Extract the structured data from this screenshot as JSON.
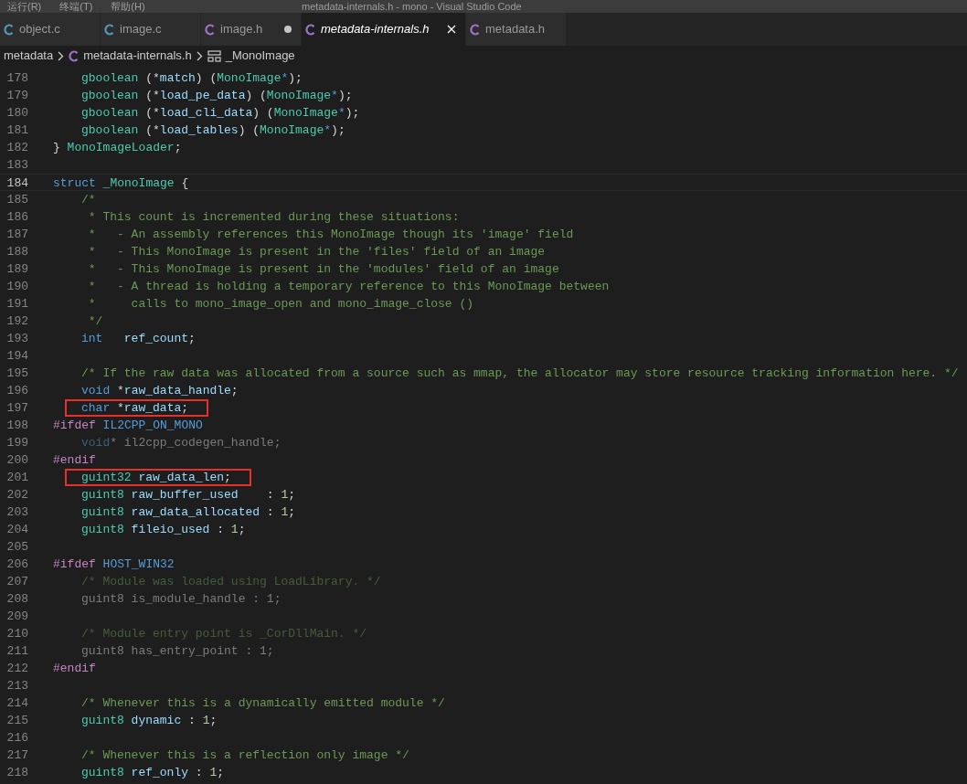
{
  "title_bar": {
    "menu": [
      "运行(R)",
      "终端(T)",
      "帮助(H)"
    ],
    "title": "metadata-internals.h - mono - Visual Studio Code"
  },
  "tabs": [
    {
      "label": "object.c",
      "kind": "c",
      "selected": false,
      "modified": false,
      "preview": false
    },
    {
      "label": "image.c",
      "kind": "c",
      "selected": false,
      "modified": false,
      "preview": false
    },
    {
      "label": "image.h",
      "kind": "h",
      "selected": false,
      "modified": true,
      "preview": false
    },
    {
      "label": "metadata-internals.h",
      "kind": "h",
      "selected": true,
      "modified": false,
      "preview": true
    },
    {
      "label": "metadata.h",
      "kind": "h",
      "selected": false,
      "modified": false,
      "preview": false
    }
  ],
  "breadcrumb": [
    {
      "label": "metadata",
      "kind": "folder"
    },
    {
      "label": "metadata-internals.h",
      "kind": "h"
    },
    {
      "label": "_MonoImage",
      "kind": "struct"
    }
  ],
  "lines": [
    {
      "number": "178",
      "indented": true,
      "current": false,
      "boxed": false,
      "inactive": false,
      "tokens": [
        {
          "kind": "type",
          "text": "gboolean"
        },
        {
          "kind": "plain",
          "text": " (*"
        },
        {
          "kind": "var",
          "text": "match"
        },
        {
          "kind": "plain",
          "text": ") ("
        },
        {
          "kind": "type",
          "text": "MonoImage"
        },
        {
          "kind": "keyword",
          "text": "*"
        },
        {
          "kind": "plain",
          "text": ");"
        }
      ]
    },
    {
      "number": "179",
      "indented": true,
      "current": false,
      "boxed": false,
      "inactive": false,
      "tokens": [
        {
          "kind": "type",
          "text": "gboolean"
        },
        {
          "kind": "plain",
          "text": " (*"
        },
        {
          "kind": "var",
          "text": "load_pe_data"
        },
        {
          "kind": "plain",
          "text": ") ("
        },
        {
          "kind": "type",
          "text": "MonoImage"
        },
        {
          "kind": "keyword",
          "text": "*"
        },
        {
          "kind": "plain",
          "text": ");"
        }
      ]
    },
    {
      "number": "180",
      "indented": true,
      "current": false,
      "boxed": false,
      "inactive": false,
      "tokens": [
        {
          "kind": "type",
          "text": "gboolean"
        },
        {
          "kind": "plain",
          "text": " (*"
        },
        {
          "kind": "var",
          "text": "load_cli_data"
        },
        {
          "kind": "plain",
          "text": ") ("
        },
        {
          "kind": "type",
          "text": "MonoImage"
        },
        {
          "kind": "keyword",
          "text": "*"
        },
        {
          "kind": "plain",
          "text": ");"
        }
      ]
    },
    {
      "number": "181",
      "indented": true,
      "current": false,
      "boxed": false,
      "inactive": false,
      "tokens": [
        {
          "kind": "type",
          "text": "gboolean"
        },
        {
          "kind": "plain",
          "text": " (*"
        },
        {
          "kind": "var",
          "text": "load_tables"
        },
        {
          "kind": "plain",
          "text": ") ("
        },
        {
          "kind": "type",
          "text": "MonoImage"
        },
        {
          "kind": "keyword",
          "text": "*"
        },
        {
          "kind": "plain",
          "text": ");"
        }
      ]
    },
    {
      "number": "182",
      "indented": false,
      "current": false,
      "boxed": false,
      "inactive": false,
      "tokens": [
        {
          "kind": "plain",
          "text": "} "
        },
        {
          "kind": "type",
          "text": "MonoImageLoader"
        },
        {
          "kind": "plain",
          "text": ";"
        }
      ]
    },
    {
      "number": "183",
      "current": false
    },
    {
      "number": "184",
      "indented": false,
      "current": true,
      "boxed": false,
      "inactive": false,
      "tokens": [
        {
          "kind": "keyword",
          "text": "struct "
        },
        {
          "kind": "type",
          "text": "_MonoImage"
        },
        {
          "kind": "plain",
          "text": " {"
        }
      ]
    },
    {
      "number": "185",
      "indented": true,
      "current": false,
      "boxed": false,
      "inactive": false,
      "tokens": [
        {
          "kind": "comment",
          "text": "/*"
        }
      ]
    },
    {
      "number": "186",
      "indented": true,
      "current": false,
      "boxed": false,
      "inactive": false,
      "tokens": [
        {
          "kind": "comment",
          "text": " * This count is incremented during these situations:"
        }
      ]
    },
    {
      "number": "187",
      "indented": true,
      "current": false,
      "boxed": false,
      "inactive": false,
      "tokens": [
        {
          "kind": "comment",
          "text": " *   - An assembly references this MonoImage though its 'image' field"
        }
      ]
    },
    {
      "number": "188",
      "indented": true,
      "current": false,
      "boxed": false,
      "inactive": false,
      "tokens": [
        {
          "kind": "comment",
          "text": " *   - This MonoImage is present in the 'files' field of an image"
        }
      ]
    },
    {
      "number": "189",
      "indented": true,
      "current": false,
      "boxed": false,
      "inactive": false,
      "tokens": [
        {
          "kind": "comment",
          "text": " *   - This MonoImage is present in the 'modules' field of an image"
        }
      ]
    },
    {
      "number": "190",
      "indented": true,
      "current": false,
      "boxed": false,
      "inactive": false,
      "tokens": [
        {
          "kind": "comment",
          "text": " *   - A thread is holding a temporary reference to this MonoImage between"
        }
      ]
    },
    {
      "number": "191",
      "indented": true,
      "current": false,
      "boxed": false,
      "inactive": false,
      "tokens": [
        {
          "kind": "comment",
          "text": " *     calls to mono_image_open and mono_image_close ()"
        }
      ]
    },
    {
      "number": "192",
      "indented": true,
      "current": false,
      "boxed": false,
      "inactive": false,
      "tokens": [
        {
          "kind": "comment",
          "text": " */"
        }
      ]
    },
    {
      "number": "193",
      "indented": true,
      "current": false,
      "boxed": false,
      "inactive": false,
      "tokens": [
        {
          "kind": "keyword",
          "text": "int   "
        },
        {
          "kind": "var",
          "text": "ref_count"
        },
        {
          "kind": "plain",
          "text": ";"
        }
      ]
    },
    {
      "number": "194",
      "current": false
    },
    {
      "number": "195",
      "indented": true,
      "current": false,
      "boxed": false,
      "inactive": false,
      "tokens": [
        {
          "kind": "comment",
          "text": "/* If the raw data was allocated from a source such as mmap, the allocator may store resource tracking information here. */"
        }
      ]
    },
    {
      "number": "196",
      "indented": true,
      "current": false,
      "boxed": false,
      "inactive": false,
      "tokens": [
        {
          "kind": "keyword",
          "text": "void"
        },
        {
          "kind": "plain",
          "text": " *"
        },
        {
          "kind": "var",
          "text": "raw_data_handle"
        },
        {
          "kind": "plain",
          "text": ";"
        }
      ]
    },
    {
      "number": "197",
      "indented": true,
      "current": false,
      "boxed": true,
      "inactive": false,
      "tokens": [
        {
          "kind": "keyword",
          "text": "char"
        },
        {
          "kind": "plain",
          "text": " *"
        },
        {
          "kind": "var",
          "text": "raw_data"
        },
        {
          "kind": "plain",
          "text": ";"
        }
      ]
    },
    {
      "number": "198",
      "indented": false,
      "current": false,
      "boxed": false,
      "inactive": false,
      "tokens": [
        {
          "kind": "macro",
          "text": "#ifdef "
        },
        {
          "kind": "keyword",
          "text": "IL2CPP_ON_MONO"
        }
      ]
    },
    {
      "number": "199",
      "indented": true,
      "current": false,
      "boxed": false,
      "inactive": true,
      "tokens": [
        {
          "kind": "keyword",
          "text": "void"
        },
        {
          "kind": "plain",
          "text": "* il2cpp_codegen_handle;"
        }
      ]
    },
    {
      "number": "200",
      "indented": false,
      "current": false,
      "boxed": false,
      "inactive": false,
      "tokens": [
        {
          "kind": "macro",
          "text": "#endif"
        }
      ]
    },
    {
      "number": "201",
      "indented": true,
      "current": false,
      "boxed": true,
      "inactive": false,
      "tokens": [
        {
          "kind": "type",
          "text": "guint32 "
        },
        {
          "kind": "var",
          "text": "raw_data_len"
        },
        {
          "kind": "plain",
          "text": ";"
        }
      ]
    },
    {
      "number": "202",
      "indented": true,
      "current": false,
      "boxed": false,
      "inactive": false,
      "tokens": [
        {
          "kind": "type",
          "text": "guint8 "
        },
        {
          "kind": "var",
          "text": "raw_buffer_used"
        },
        {
          "kind": "plain",
          "text": "    : "
        },
        {
          "kind": "number",
          "text": "1"
        },
        {
          "kind": "plain",
          "text": ";"
        }
      ]
    },
    {
      "number": "203",
      "indented": true,
      "current": false,
      "boxed": false,
      "inactive": false,
      "tokens": [
        {
          "kind": "type",
          "text": "guint8 "
        },
        {
          "kind": "var",
          "text": "raw_data_allocated"
        },
        {
          "kind": "plain",
          "text": " : "
        },
        {
          "kind": "number",
          "text": "1"
        },
        {
          "kind": "plain",
          "text": ";"
        }
      ]
    },
    {
      "number": "204",
      "indented": true,
      "current": false,
      "boxed": false,
      "inactive": false,
      "tokens": [
        {
          "kind": "type",
          "text": "guint8 "
        },
        {
          "kind": "var",
          "text": "fileio_used"
        },
        {
          "kind": "plain",
          "text": " : "
        },
        {
          "kind": "number",
          "text": "1"
        },
        {
          "kind": "plain",
          "text": ";"
        }
      ]
    },
    {
      "number": "205",
      "current": false
    },
    {
      "number": "206",
      "indented": false,
      "current": false,
      "boxed": false,
      "inactive": false,
      "tokens": [
        {
          "kind": "macro",
          "text": "#ifdef "
        },
        {
          "kind": "keyword",
          "text": "HOST_WIN32"
        }
      ]
    },
    {
      "number": "207",
      "indented": true,
      "current": false,
      "boxed": false,
      "inactive": true,
      "tokens": [
        {
          "kind": "comment",
          "text": "/* Module was loaded using LoadLibrary. */"
        }
      ]
    },
    {
      "number": "208",
      "indented": true,
      "current": false,
      "boxed": false,
      "inactive": true,
      "tokens": [
        {
          "kind": "plain",
          "text": "guint8 is_module_handle : 1;"
        }
      ]
    },
    {
      "number": "209",
      "current": false
    },
    {
      "number": "210",
      "indented": true,
      "current": false,
      "boxed": false,
      "inactive": true,
      "tokens": [
        {
          "kind": "comment",
          "text": "/* Module entry point is _CorDllMain. */"
        }
      ]
    },
    {
      "number": "211",
      "indented": true,
      "current": false,
      "boxed": false,
      "inactive": true,
      "tokens": [
        {
          "kind": "plain",
          "text": "guint8 has_entry_point : 1;"
        }
      ]
    },
    {
      "number": "212",
      "indented": false,
      "current": false,
      "boxed": false,
      "inactive": false,
      "tokens": [
        {
          "kind": "macro",
          "text": "#endif"
        }
      ]
    },
    {
      "number": "213",
      "current": false
    },
    {
      "number": "214",
      "indented": true,
      "current": false,
      "boxed": false,
      "inactive": false,
      "tokens": [
        {
          "kind": "comment",
          "text": "/* Whenever this is a dynamically emitted module */"
        }
      ]
    },
    {
      "number": "215",
      "indented": true,
      "current": false,
      "boxed": false,
      "inactive": false,
      "tokens": [
        {
          "kind": "type",
          "text": "guint8 "
        },
        {
          "kind": "var",
          "text": "dynamic"
        },
        {
          "kind": "plain",
          "text": " : "
        },
        {
          "kind": "number",
          "text": "1"
        },
        {
          "kind": "plain",
          "text": ";"
        }
      ]
    },
    {
      "number": "216",
      "current": false
    },
    {
      "number": "217",
      "indented": true,
      "current": false,
      "boxed": false,
      "inactive": false,
      "tokens": [
        {
          "kind": "comment",
          "text": "/* Whenever this is a reflection only image */"
        }
      ]
    },
    {
      "number": "218",
      "indented": true,
      "current": false,
      "boxed": false,
      "inactive": false,
      "tokens": [
        {
          "kind": "type",
          "text": "guint8 "
        },
        {
          "kind": "var",
          "text": "ref_only"
        },
        {
          "kind": "plain",
          "text": " : "
        },
        {
          "kind": "number",
          "text": "1"
        },
        {
          "kind": "plain",
          "text": ";"
        }
      ]
    }
  ]
}
